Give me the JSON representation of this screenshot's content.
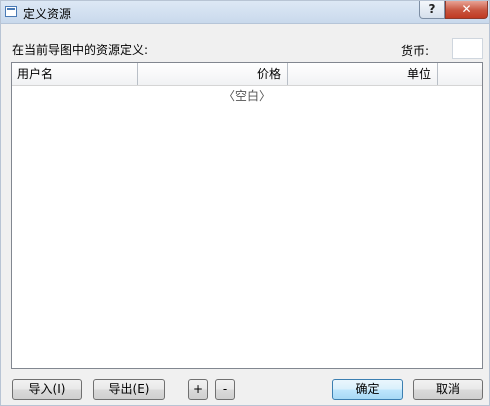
{
  "window": {
    "title": "定义资源",
    "help_glyph": "?",
    "close_glyph": "✕"
  },
  "labels": {
    "resource_definitions": "在当前导图中的资源定义:",
    "currency": "货币:"
  },
  "currency_input": {
    "value": ""
  },
  "table": {
    "columns": [
      "用户名",
      "价格",
      "单位"
    ],
    "rows": [],
    "empty_text": "〈空白〉"
  },
  "buttons": {
    "import": "导入(I)",
    "export": "导出(E)",
    "add": "+",
    "remove": "-",
    "ok": "确定",
    "cancel": "取消"
  }
}
